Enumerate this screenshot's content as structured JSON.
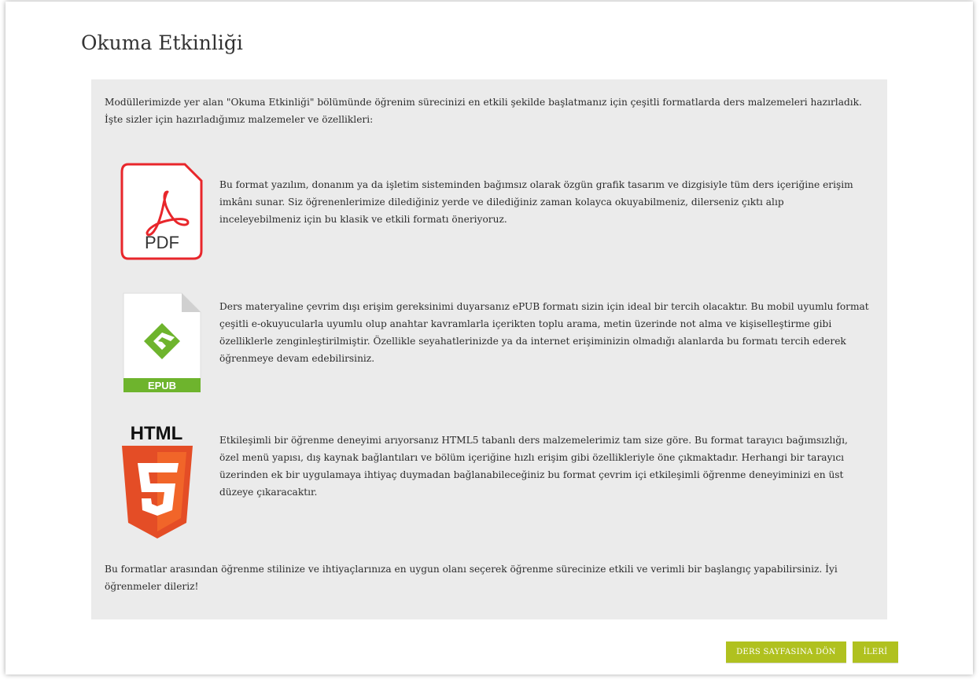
{
  "page": {
    "title": "Okuma Etkinliği"
  },
  "content": {
    "intro": "Modüllerimizde yer alan \"Okuma Etkinliği\" bölümünde öğrenim sürecinizi en etkili şekilde başlatmanız için çeşitli formatlarda ders malzemeleri hazırladık. İşte sizler için hazırladığımız malzemeler ve özellikleri:",
    "formats": [
      {
        "icon": "pdf-icon",
        "label": "PDF",
        "accent": "#e8262b",
        "description": "Bu format yazılım, donanım ya da işletim sisteminden bağımsız olarak özgün grafik tasarım ve dizgisiyle tüm ders içeriğine erişim imkânı sunar. Siz öğrenenlerimize dilediğiniz yerde ve dilediğiniz zaman kolayca okuyabilmeniz, dilerseniz çıktı alıp inceleyebilmeniz için bu klasik ve etkili formatı öneriyoruz."
      },
      {
        "icon": "epub-icon",
        "label": "EPUB",
        "accent": "#6eb42d",
        "description": "Ders materyaline çevrim dışı erişim gereksinimi duyarsanız ePUB formatı sizin için ideal bir tercih olacaktır. Bu mobil uyumlu format çeşitli e-okuyucularla uyumlu olup anahtar kavramlarla içerikten toplu arama, metin üzerinde not alma ve kişiselleştirme gibi özelliklerle zenginleştirilmiştir. Özellikle seyahatlerinizde ya da internet erişiminizin olmadığı alanlarda bu formatı tercih ederek öğrenmeye devam edebilirsiniz."
      },
      {
        "icon": "html5-icon",
        "label": "HTML",
        "accent": "#e44d26",
        "description": "Etkileşimli bir öğrenme deneyimi arıyorsanız HTML5 tabanlı ders malzemelerimiz tam size göre. Bu format tarayıcı bağımsızlığı, özel menü yapısı, dış kaynak bağlantıları ve bölüm içeriğine hızlı erişim gibi özellikleriyle öne çıkmaktadır. Herhangi bir tarayıcı üzerinden ek bir uygulamaya ihtiyaç duymadan bağlanabileceğiniz bu format çevrim içi etkileşimli öğrenme deneyiminizi en üst düzeye çıkaracaktır."
      }
    ],
    "outro": "Bu formatlar arasından öğrenme stilinize ve ihtiyaçlarınıza en uygun olanı seçerek öğrenme sürecinize etkili ve verimli bir başlangıç yapabilirsiniz. İyi öğrenmeler dileriz!"
  },
  "buttons": {
    "back_label": "DERS SAYFASINA DÖN",
    "next_label": "İLERİ"
  },
  "colors": {
    "button_bg": "#b0c11f",
    "panel_bg": "#ebebeb"
  }
}
